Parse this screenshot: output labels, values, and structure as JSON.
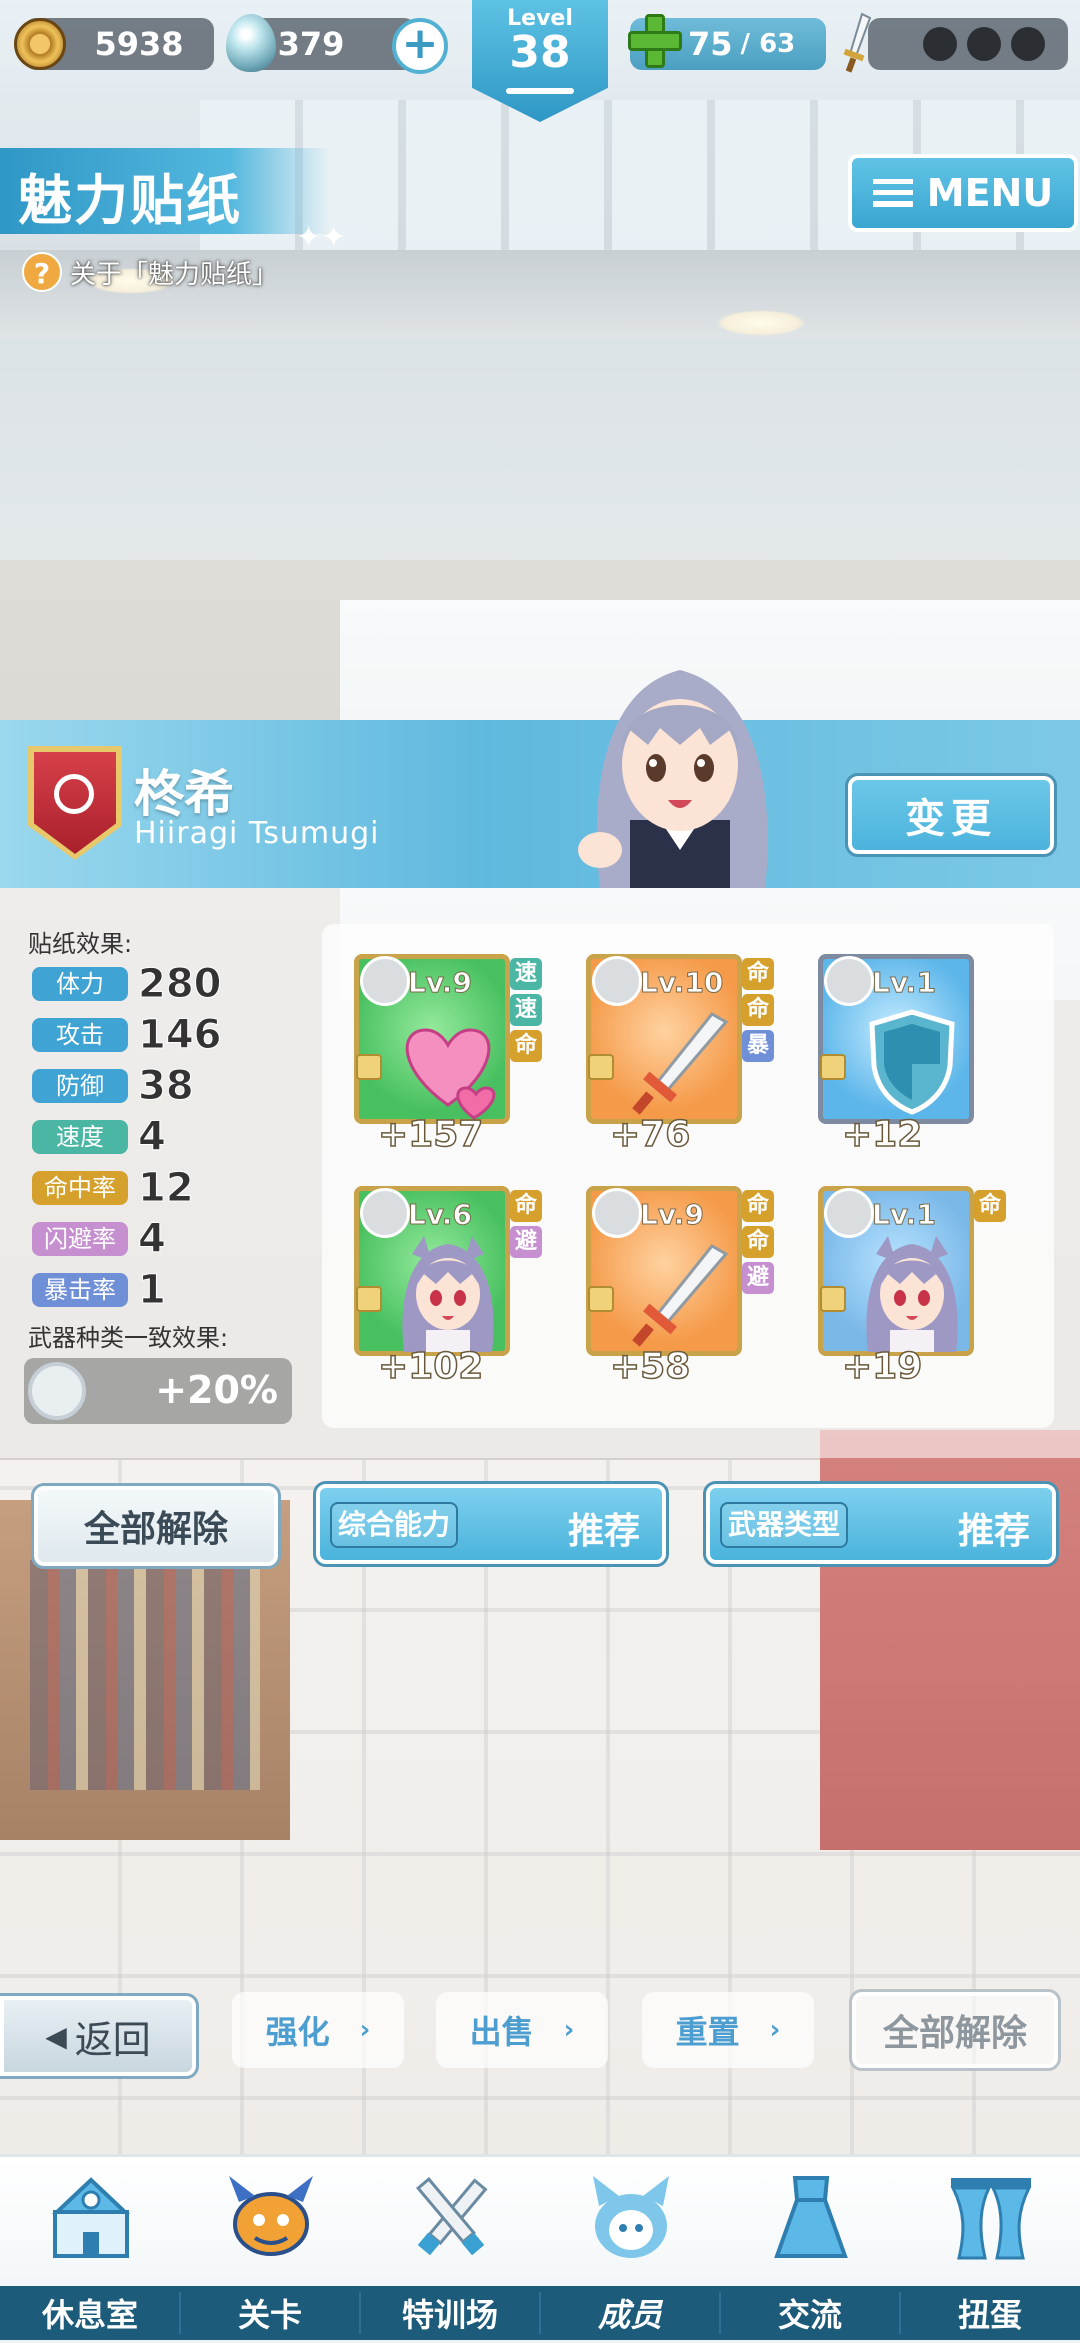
{
  "topbar": {
    "coins": "5938",
    "gems": "379",
    "level_label": "Level",
    "level": "38",
    "stamina_current": "75",
    "stamina_max": "/ 63"
  },
  "header": {
    "title": "魅力贴纸",
    "about": "关于「魅力贴纸」",
    "menu": "MENU"
  },
  "character": {
    "name": "柊希",
    "romanized": "Hiiragi Tsumugi",
    "change": "变更"
  },
  "effects": {
    "title": "贴纸效果:",
    "stats": [
      {
        "label": "体力",
        "value": "280",
        "color": "#3fa3d4"
      },
      {
        "label": "攻击",
        "value": "146",
        "color": "#3fa3d4"
      },
      {
        "label": "防御",
        "value": "38",
        "color": "#3fa3d4"
      },
      {
        "label": "速度",
        "value": "4",
        "color": "#4cb6a5"
      },
      {
        "label": "命中率",
        "value": "12",
        "color": "#d6a02c"
      },
      {
        "label": "闪避率",
        "value": "4",
        "color": "#c68fd0"
      },
      {
        "label": "暴击率",
        "value": "1",
        "color": "#6f8fd6"
      }
    ],
    "weapon_title": "武器种类一致效果:",
    "weapon_bonus": "+20%"
  },
  "stickers": [
    {
      "level": "Lv.9",
      "bonus": "+157",
      "bg": "green",
      "art": "hearts-icon",
      "tags": [
        {
          "t": "速",
          "c": "#4cb6a5"
        },
        {
          "t": "速",
          "c": "#4cb6a5"
        },
        {
          "t": "命",
          "c": "#d6a02c"
        }
      ]
    },
    {
      "level": "Lv.10",
      "bonus": "+76",
      "bg": "orange",
      "art": "sword-icon",
      "tags": [
        {
          "t": "命",
          "c": "#d6a02c"
        },
        {
          "t": "命",
          "c": "#d6a02c"
        },
        {
          "t": "暴",
          "c": "#6f8fd6"
        }
      ]
    },
    {
      "level": "Lv.1",
      "bonus": "+12",
      "bg": "blue",
      "art": "shield-icon",
      "tags": []
    },
    {
      "level": "Lv.6",
      "bonus": "+102",
      "bg": "green",
      "art": "girl-portrait",
      "tags": [
        {
          "t": "命",
          "c": "#d6a02c"
        },
        {
          "t": "避",
          "c": "#c68fd0"
        }
      ]
    },
    {
      "level": "Lv.9",
      "bonus": "+58",
      "bg": "orange",
      "art": "sword-icon",
      "tags": [
        {
          "t": "命",
          "c": "#d6a02c"
        },
        {
          "t": "命",
          "c": "#d6a02c"
        },
        {
          "t": "避",
          "c": "#c68fd0"
        }
      ]
    },
    {
      "level": "Lv.1",
      "bonus": "+19",
      "bg": "gblue",
      "art": "girl-portrait",
      "tags": [
        {
          "t": "命",
          "c": "#d6a02c"
        }
      ]
    }
  ],
  "actions": {
    "release_all": "全部解除",
    "rec1_sub": "综合能力",
    "rec1_main": "推荐",
    "rec2_sub": "武器类型",
    "rec2_main": "推荐"
  },
  "bottom_actions": {
    "back": "返回",
    "enhance": "强化",
    "sell": "出售",
    "reset": "重置",
    "release_all": "全部解除"
  },
  "nav": [
    {
      "label": "休息室",
      "icon": "school-icon"
    },
    {
      "label": "关卡",
      "icon": "monster-icon"
    },
    {
      "label": "特训场",
      "icon": "crossed-swords-icon"
    },
    {
      "label": "成员",
      "icon": "member-cat-icon"
    },
    {
      "label": "交流",
      "icon": "dress-icon"
    },
    {
      "label": "扭蛋",
      "icon": "curtain-icon"
    }
  ]
}
